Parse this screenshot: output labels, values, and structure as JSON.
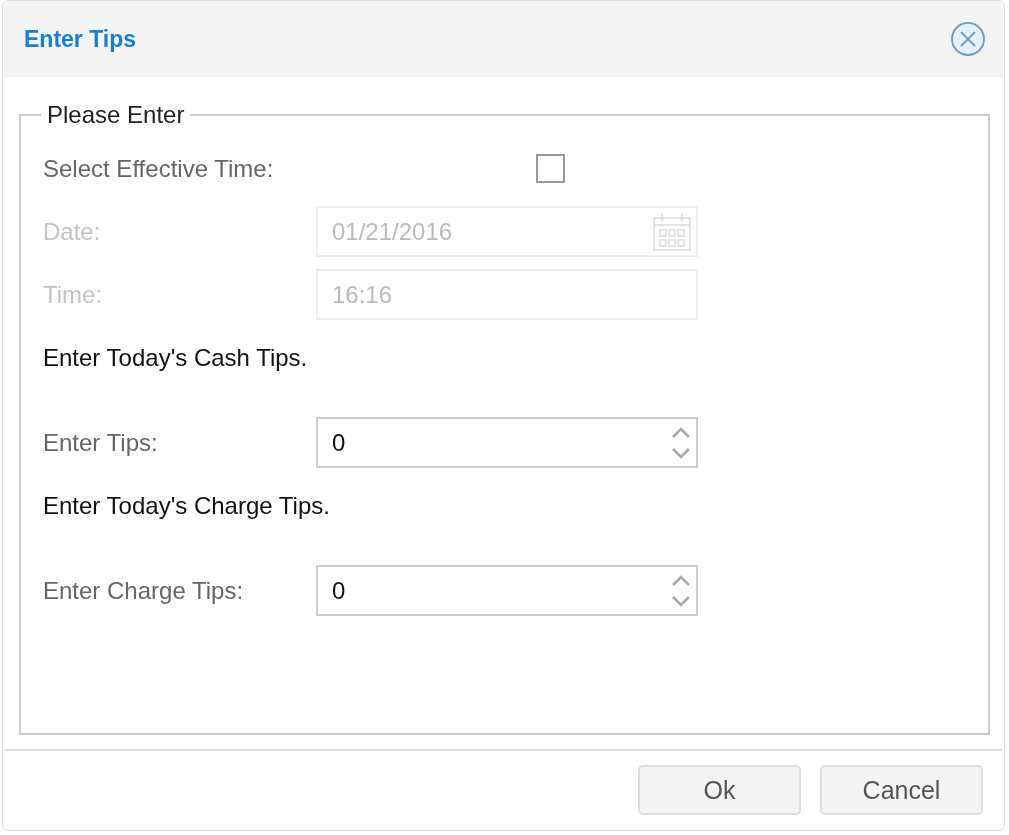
{
  "window": {
    "title": "Enter Tips"
  },
  "fieldset": {
    "legend": "Please Enter",
    "rows": [
      {
        "kind": "checkbox",
        "label": "Select Effective Time:",
        "checked": false
      },
      {
        "kind": "date",
        "label": "Date:",
        "value": "01/21/2016",
        "disabled": true
      },
      {
        "kind": "time",
        "label": "Time:",
        "value": "16:16",
        "disabled": true
      },
      {
        "kind": "note",
        "text": "Enter Today's Cash Tips."
      },
      {
        "kind": "spinner",
        "label": "Enter Tips:",
        "value": "0",
        "disabled": false
      },
      {
        "kind": "note",
        "text": "Enter Today's Charge Tips."
      },
      {
        "kind": "spinner",
        "label": "Enter Charge Tips:",
        "value": "0",
        "disabled": false
      }
    ]
  },
  "buttons": [
    "Ok",
    "Cancel"
  ]
}
